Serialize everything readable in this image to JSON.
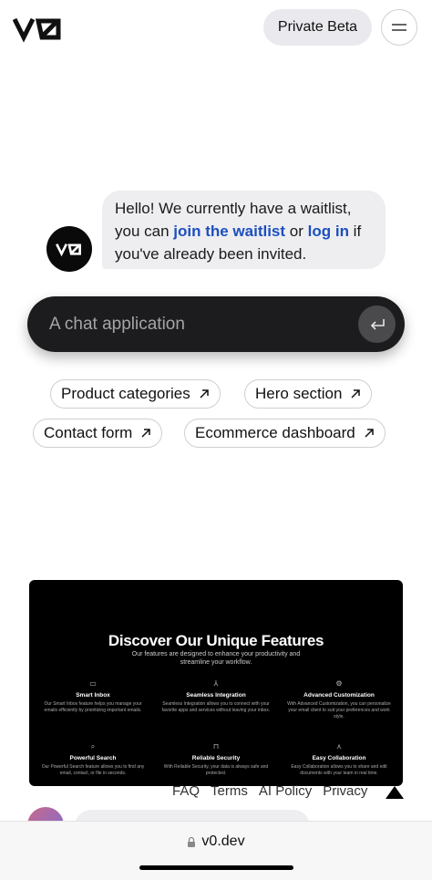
{
  "header": {
    "logo_text": "v0",
    "beta_button": "Private Beta",
    "menu_icon": "hamburger-icon"
  },
  "assistant": {
    "avatar_text": "v0",
    "message_prefix": "Hello! We currently have a waitlist, you can ",
    "waitlist_link": "join the waitlist",
    "message_middle": " or ",
    "login_link": "log in",
    "message_suffix": " if you've already been invited."
  },
  "prompt": {
    "placeholder": "A chat application",
    "submit_icon": "enter-return-icon"
  },
  "suggestions": [
    {
      "label": "Product categories"
    },
    {
      "label": "Hero section"
    },
    {
      "label": "Contact form"
    },
    {
      "label": "Ecommerce dashboard"
    }
  ],
  "preview": {
    "title": "Discover Our Unique Features",
    "subtitle": "Our features are designed to enhance your productivity and streamline your workflow.",
    "features": [
      {
        "icon": "inbox-icon",
        "title": "Smart Inbox",
        "desc": "Our Smart Inbox feature helps you manage your emails efficiently by prioritizing important emails."
      },
      {
        "icon": "merge-icon",
        "title": "Seamless Integration",
        "desc": "Seamless Integration allows you to connect with your favorite apps and services without leaving your inbox."
      },
      {
        "icon": "gear-icon",
        "title": "Advanced Customization",
        "desc": "With Advanced Customization, you can personalize your email client to suit your preferences and work style."
      },
      {
        "icon": "search-icon",
        "title": "Powerful Search",
        "desc": "Our Powerful Search feature allows you to find any email, contact, or file in seconds."
      },
      {
        "icon": "lock-icon",
        "title": "Reliable Security",
        "desc": "With Reliable Security, your data is always safe and protected."
      },
      {
        "icon": "users-icon",
        "title": "Easy Collaboration",
        "desc": "Easy Collaboration allows you to share and edit documents with your team in real time."
      }
    ]
  },
  "footer": {
    "links": [
      "FAQ",
      "Terms",
      "AI Policy",
      "Privacy"
    ]
  },
  "browser": {
    "url": "v0.dev"
  }
}
